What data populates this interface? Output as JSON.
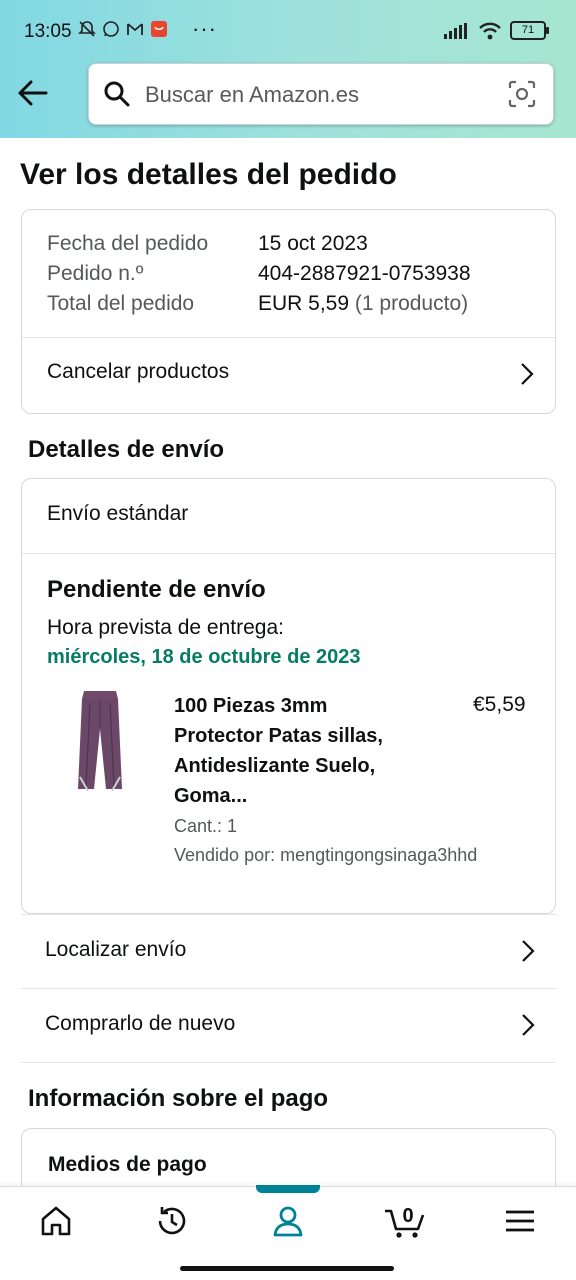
{
  "status_bar": {
    "time": "13:05",
    "battery": "71"
  },
  "header": {
    "search_placeholder": "Buscar en Amazon.es",
    "accent": "#008296"
  },
  "page": {
    "title": "Ver los detalles del pedido"
  },
  "order_summary": {
    "rows": [
      {
        "label": "Fecha del pedido",
        "value": "15 oct 2023"
      },
      {
        "label": "Pedido n.º",
        "value": "404-2887921-0753938"
      },
      {
        "label": "Total del pedido",
        "value": "EUR 5,59",
        "extra": "(1 producto)"
      }
    ],
    "cancel_label": "Cancelar productos"
  },
  "shipping": {
    "heading": "Detalles de envío",
    "method": "Envío estándar",
    "status": "Pendiente de envío",
    "eta_label": "Hora prevista de entrega:",
    "eta_date": "miércoles, 18 de octubre de 2023",
    "eta_color": "#067d62",
    "product": {
      "name_lines": [
        "100 Piezas 3mm",
        "Protector Patas sillas,",
        "Antideslizante Suelo,",
        "Goma..."
      ],
      "price": "€5,59",
      "qty": "Cant.: 1",
      "seller": "Vendido por: mengtingongsinaga3hhd"
    },
    "track_label": "Localizar envío",
    "buy_again_label": "Comprarlo de nuevo"
  },
  "payment": {
    "heading": "Información sobre el pago",
    "methods_label": "Medios de pago"
  },
  "bottom_nav": {
    "items": [
      "home-icon",
      "history-icon",
      "account-icon",
      "cart-icon",
      "menu-icon"
    ],
    "cart_count": "0",
    "active": "account-icon"
  }
}
